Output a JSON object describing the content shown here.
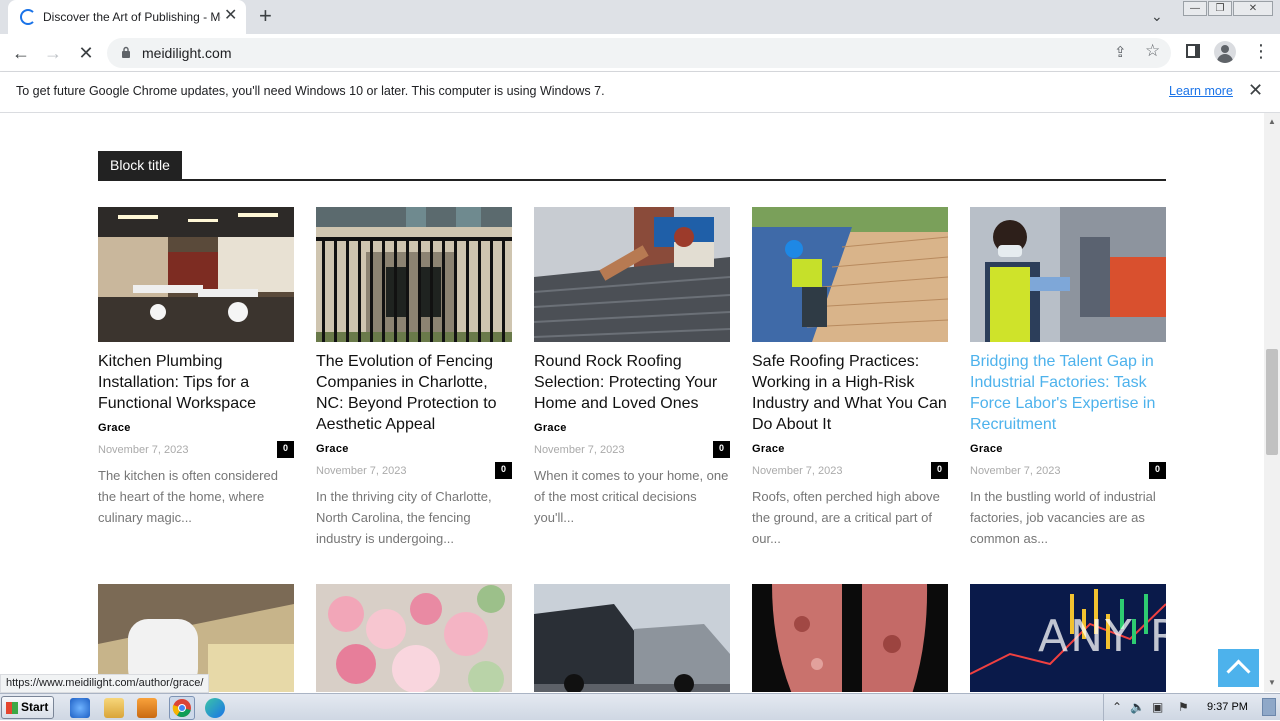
{
  "browser": {
    "tab_title": "Discover the Art of Publishing - Meidilight",
    "url": "meidilight.com",
    "infobar_message": "To get future Google Chrome updates, you'll need Windows 10 or later. This computer is using Windows 7.",
    "infobar_link": "Learn more",
    "status_url": "https://www.meidilight.com/author/grace/"
  },
  "page": {
    "block_title": "Block title",
    "watermark": "ANY RUN",
    "articles": [
      {
        "title": "Kitchen Plumbing Installation: Tips for a Functional Workspace",
        "author": "Grace",
        "date": "November 7, 2023",
        "comments": "0",
        "excerpt": "The kitchen is often considered the heart of the home, where culinary magic..."
      },
      {
        "title": "The Evolution of Fencing Companies in Charlotte, NC: Beyond Protection to Aesthetic Appeal",
        "author": "Grace",
        "date": "November 7, 2023",
        "comments": "0",
        "excerpt": "In the thriving city of Charlotte, North Carolina, the fencing industry is undergoing..."
      },
      {
        "title": "Round Rock Roofing Selection: Protecting Your Home and Loved Ones",
        "author": "Grace",
        "date": "November 7, 2023",
        "comments": "0",
        "excerpt": "When it comes to your home, one of the most critical decisions you'll..."
      },
      {
        "title": "Safe Roofing Practices: Working in a High-Risk Industry and What You Can Do About It",
        "author": "Grace",
        "date": "November 7, 2023",
        "comments": "0",
        "excerpt": "Roofs, often perched high above the ground, are a critical part of our..."
      },
      {
        "title": "Bridging the Talent Gap in Industrial Factories: Task Force Labor's Expertise in Recruitment",
        "author": "Grace",
        "date": "November 7, 2023",
        "comments": "0",
        "excerpt": "In the bustling world of industrial factories, job vacancies are as common as..."
      }
    ]
  },
  "taskbar": {
    "start_label": "Start",
    "clock": "9:37 PM"
  },
  "colors": {
    "accent": "#4db2ec",
    "block_title_bg": "#222222",
    "chrome_tabstrip": "#dee1e6"
  }
}
